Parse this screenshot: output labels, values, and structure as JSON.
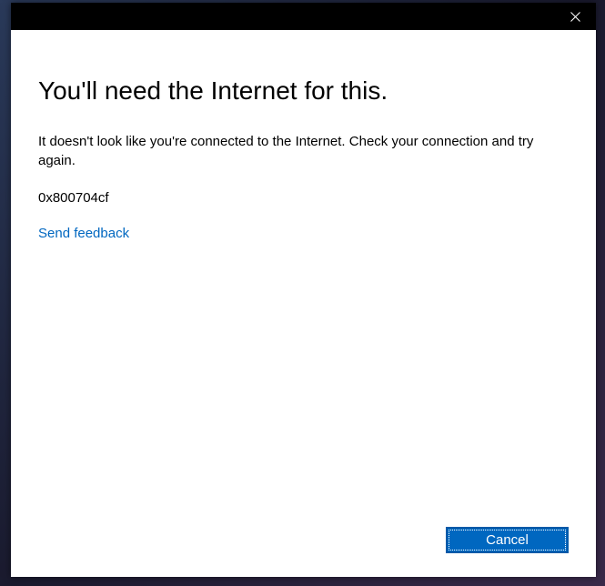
{
  "dialog": {
    "heading": "You'll need the Internet for this.",
    "body": "It doesn't look like you're connected to the Internet. Check your connection and try again.",
    "error_code": "0x800704cf",
    "feedback_link_label": "Send feedback",
    "cancel_label": "Cancel"
  },
  "icons": {
    "close": "close-icon"
  },
  "colors": {
    "accent": "#0067c0",
    "titlebar": "#000000",
    "dialog_bg": "#ffffff"
  }
}
